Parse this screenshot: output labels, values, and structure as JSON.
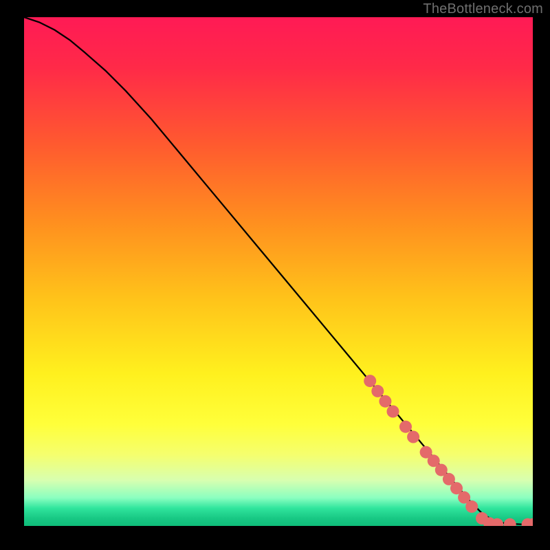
{
  "watermark": "TheBottleneck.com",
  "chart_data": {
    "type": "line",
    "title": "",
    "xlabel": "",
    "ylabel": "",
    "xlim": [
      0,
      100
    ],
    "ylim": [
      0,
      100
    ],
    "background_gradient_stops": [
      {
        "offset": 0.0,
        "color": "#ff1a55"
      },
      {
        "offset": 0.1,
        "color": "#ff2a48"
      },
      {
        "offset": 0.25,
        "color": "#ff5a2f"
      },
      {
        "offset": 0.4,
        "color": "#ff8e1f"
      },
      {
        "offset": 0.55,
        "color": "#ffc21a"
      },
      {
        "offset": 0.7,
        "color": "#fff01e"
      },
      {
        "offset": 0.8,
        "color": "#ffff3a"
      },
      {
        "offset": 0.86,
        "color": "#f5ff6e"
      },
      {
        "offset": 0.91,
        "color": "#d8ffb0"
      },
      {
        "offset": 0.945,
        "color": "#8affc0"
      },
      {
        "offset": 0.965,
        "color": "#30e59d"
      },
      {
        "offset": 0.985,
        "color": "#18c884"
      },
      {
        "offset": 1.0,
        "color": "#0fbd7a"
      }
    ],
    "series": [
      {
        "name": "bottleneck-curve",
        "x": [
          0,
          3,
          6,
          9,
          12,
          16,
          20,
          25,
          30,
          35,
          40,
          45,
          50,
          55,
          60,
          65,
          70,
          75,
          80,
          85,
          88,
          90,
          92,
          94,
          96,
          98,
          100
        ],
        "y": [
          100,
          99,
          97.5,
          95.5,
          93,
          89.5,
          85.5,
          80,
          74,
          68,
          62,
          56,
          50,
          44,
          38,
          32,
          26,
          20,
          14,
          8,
          4.5,
          2.5,
          1.2,
          0.6,
          0.4,
          0.3,
          0.3
        ]
      }
    ],
    "markers": {
      "name": "highlight-dots",
      "color": "#e46a6a",
      "radius": 9,
      "points": [
        {
          "x": 68,
          "y": 28.5
        },
        {
          "x": 69.5,
          "y": 26.5
        },
        {
          "x": 71,
          "y": 24.5
        },
        {
          "x": 72.5,
          "y": 22.5
        },
        {
          "x": 75,
          "y": 19.5
        },
        {
          "x": 76.5,
          "y": 17.5
        },
        {
          "x": 79,
          "y": 14.5
        },
        {
          "x": 80.5,
          "y": 12.8
        },
        {
          "x": 82,
          "y": 11
        },
        {
          "x": 83.5,
          "y": 9.2
        },
        {
          "x": 85,
          "y": 7.4
        },
        {
          "x": 86.5,
          "y": 5.6
        },
        {
          "x": 88,
          "y": 3.8
        },
        {
          "x": 90,
          "y": 1.5
        },
        {
          "x": 91.5,
          "y": 0.5
        },
        {
          "x": 93,
          "y": 0.3
        },
        {
          "x": 95.5,
          "y": 0.3
        },
        {
          "x": 99,
          "y": 0.3
        },
        {
          "x": 100,
          "y": 0.3
        }
      ]
    }
  }
}
